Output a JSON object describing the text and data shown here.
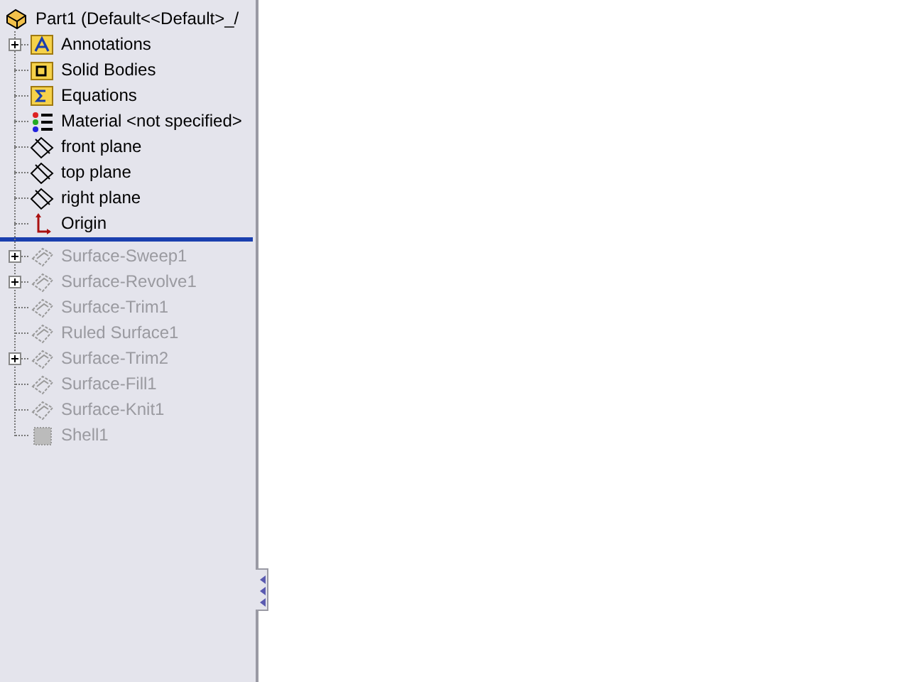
{
  "tree": {
    "root": {
      "label": "Part1  (Default<<Default>_/"
    },
    "items": [
      {
        "label": "Annotations",
        "kind": "annotations",
        "expandable": true,
        "rolled_back": false
      },
      {
        "label": "Solid Bodies",
        "kind": "bodies",
        "expandable": false,
        "rolled_back": false
      },
      {
        "label": "Equations",
        "kind": "equations",
        "expandable": false,
        "rolled_back": false
      },
      {
        "label": "Material <not specified>",
        "kind": "material",
        "expandable": false,
        "rolled_back": false
      },
      {
        "label": "front plane",
        "kind": "plane",
        "expandable": false,
        "rolled_back": false
      },
      {
        "label": "top plane",
        "kind": "plane",
        "expandable": false,
        "rolled_back": false
      },
      {
        "label": "right plane",
        "kind": "plane",
        "expandable": false,
        "rolled_back": false
      },
      {
        "label": "Origin",
        "kind": "origin",
        "expandable": false,
        "rolled_back": false
      },
      {
        "label": "Surface-Sweep1",
        "kind": "surface",
        "expandable": true,
        "rolled_back": true
      },
      {
        "label": "Surface-Revolve1",
        "kind": "surface",
        "expandable": true,
        "rolled_back": true
      },
      {
        "label": "Surface-Trim1",
        "kind": "surface",
        "expandable": false,
        "rolled_back": true
      },
      {
        "label": "Ruled Surface1",
        "kind": "surface",
        "expandable": false,
        "rolled_back": true
      },
      {
        "label": "Surface-Trim2",
        "kind": "surface",
        "expandable": true,
        "rolled_back": true
      },
      {
        "label": "Surface-Fill1",
        "kind": "surface",
        "expandable": false,
        "rolled_back": true
      },
      {
        "label": "Surface-Knit1",
        "kind": "surface",
        "expandable": false,
        "rolled_back": true
      },
      {
        "label": "Shell1",
        "kind": "shell",
        "expandable": false,
        "rolled_back": true
      }
    ]
  }
}
